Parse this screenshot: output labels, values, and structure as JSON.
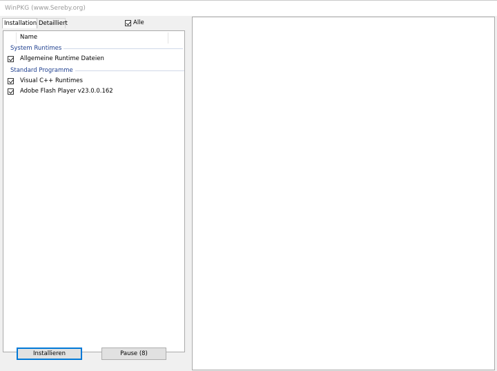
{
  "window": {
    "title": "WinPKG (www.Sereby.org)"
  },
  "tabs": [
    {
      "label": "Installation",
      "active": true
    },
    {
      "label": "Detailliert",
      "active": false
    }
  ],
  "select_all": {
    "label": "Alle",
    "checked": true
  },
  "list": {
    "column_header": "Name",
    "groups": [
      {
        "title": "System Runtimes",
        "items": [
          {
            "label": "Allgemeine Runtime Dateien",
            "checked": true
          }
        ]
      },
      {
        "title": "Standard Programme",
        "items": [
          {
            "label": "Visual C++ Runtimes",
            "checked": true
          },
          {
            "label": "Adobe Flash Player v23.0.0.162",
            "checked": true
          }
        ]
      }
    ]
  },
  "buttons": {
    "install_label": "Installieren",
    "pause_label": "Pause (8)"
  },
  "colors": {
    "group_header": "#1e3f8f",
    "focus_border": "#0078d7",
    "window_bg": "#f0f0f0"
  }
}
